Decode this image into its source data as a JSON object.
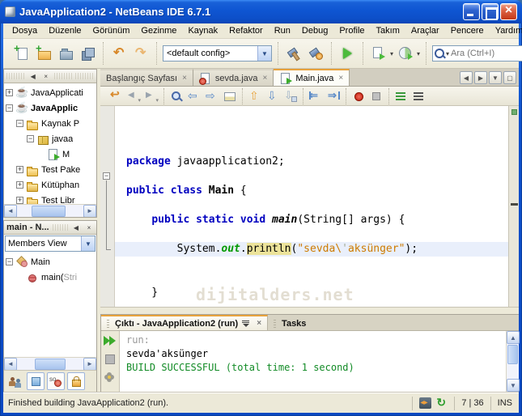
{
  "colors": {
    "keyword_blue": "#0000c0",
    "string_orange": "#ce7b00",
    "field_green": "#009900",
    "build_success_green": "#128b26",
    "active_tab_accent": "#e8a33d",
    "xp_titlebar_blue": "#0e55d2"
  },
  "window": {
    "title": "JavaApplication2 - NetBeans IDE 6.7.1",
    "controls": {
      "minimize": "minimize",
      "maximize": "maximize",
      "close": "close"
    }
  },
  "menubar": [
    "Dosya",
    "Düzenle",
    "Görünüm",
    "Gezinme",
    "Kaynak",
    "Refaktor",
    "Run",
    "Debug",
    "Profile",
    "Takım",
    "Araçlar",
    "Pencere",
    "Yardım"
  ],
  "toolbar": {
    "file_icons": [
      "new-file",
      "new-project",
      "open-project",
      "save-all"
    ],
    "edit_icons": [
      "undo",
      "redo"
    ],
    "config_combo_value": "<default config>",
    "build_icons": [
      "build-project",
      "clean-build-project"
    ],
    "run_icons": [
      "run-project"
    ],
    "dropdown_icons": [
      "debug-project",
      "profile-project"
    ],
    "search_placeholder": "Ara (Ctrl+I)"
  },
  "projects_panel": {
    "items": [
      {
        "label": "JavaApplicati",
        "expander": "+",
        "icon": "java-project",
        "bold": false,
        "level": 0
      },
      {
        "label": "JavaApplic",
        "expander": "-",
        "icon": "java-project",
        "bold": true,
        "level": 0
      },
      {
        "label": "Kaynak P",
        "expander": "-",
        "icon": "source-folder",
        "bold": false,
        "level": 1
      },
      {
        "label": "javaa",
        "expander": "-",
        "icon": "package",
        "bold": false,
        "level": 2
      },
      {
        "label": "M",
        "expander": null,
        "icon": "java-main-file",
        "bold": false,
        "level": 3
      },
      {
        "label": "Test Pake",
        "expander": "+",
        "icon": "source-folder",
        "bold": false,
        "level": 1
      },
      {
        "label": "Kütüphan",
        "expander": "+",
        "icon": "libraries-folder",
        "bold": false,
        "level": 1
      },
      {
        "label": "Test Libr",
        "expander": "+",
        "icon": "libraries-folder",
        "bold": false,
        "level": 1
      }
    ]
  },
  "navigator_panel": {
    "title": "main - N...",
    "view_combo_value": "Members View",
    "items": [
      {
        "label": "Main",
        "sub": "",
        "expander": "-",
        "icon": "class",
        "level": 0
      },
      {
        "label": "main(",
        "sub": "Stri",
        "expander": null,
        "icon": "method",
        "level": 1
      }
    ],
    "filter_icons": [
      "inherited-members",
      "show-fields",
      "show-static",
      "show-non-public"
    ]
  },
  "editor": {
    "tabs": [
      {
        "label": "Başlangıç Sayfası",
        "icon": null,
        "active": false
      },
      {
        "label": "sevda.java",
        "icon": "java-file-error",
        "active": false
      },
      {
        "label": "Main.java",
        "icon": "java-main-file",
        "active": true
      }
    ],
    "toolbar_groups": [
      [
        "last-edit-location",
        "back-history",
        "forward-history"
      ],
      [
        "find-selection",
        "find-previous",
        "find-next",
        "toggle-highlight"
      ],
      [
        "previous-occurrence",
        "next-occurrence",
        "toggle-bookmark"
      ],
      [
        "shift-left",
        "shift-right"
      ],
      [
        "record-macro",
        "run-macro"
      ],
      [
        "comment",
        "uncomment"
      ]
    ],
    "watermark": "dijitalders.net",
    "code_lines": [
      {
        "tokens": [
          {
            "t": "package",
            "c": "kw"
          },
          {
            "t": " javaapplication2;",
            "c": "pl"
          }
        ]
      },
      {
        "tokens": []
      },
      {
        "tokens": [
          {
            "t": "public class",
            "c": "kw"
          },
          {
            "t": " ",
            "c": "pl"
          },
          {
            "t": "Main",
            "c": "cls"
          },
          {
            "t": " {",
            "c": "pl"
          }
        ]
      },
      {
        "tokens": []
      },
      {
        "tokens": [
          {
            "t": "    ",
            "c": "pl"
          },
          {
            "t": "public static void",
            "c": "kw"
          },
          {
            "t": " ",
            "c": "pl"
          },
          {
            "t": "main",
            "c": "mtd"
          },
          {
            "t": "(String[] args) {",
            "c": "pl"
          }
        ],
        "fold_start": true
      },
      {
        "tokens": []
      },
      {
        "tokens": [
          {
            "t": "        System.",
            "c": "pl"
          },
          {
            "t": "out",
            "c": "fld"
          },
          {
            "t": ".",
            "c": "pl"
          },
          {
            "t": "println",
            "c": "pl hl"
          },
          {
            "t": "(",
            "c": "pl"
          },
          {
            "t": "\"sevda\\",
            "c": "str"
          },
          {
            "t": "'",
            "c": "esc"
          },
          {
            "t": "aksünger\"",
            "c": "str"
          },
          {
            "t": ");",
            "c": "pl"
          }
        ],
        "current": true
      },
      {
        "tokens": []
      },
      {
        "tokens": []
      },
      {
        "tokens": [
          {
            "t": "    }",
            "c": "pl"
          }
        ],
        "fold_end": true
      },
      {
        "tokens": []
      },
      {
        "tokens": [
          {
            "t": "}",
            "c": "pl"
          }
        ]
      }
    ]
  },
  "output_panel": {
    "tabs": [
      {
        "label": "Çıktı - JavaApplication2 (run)",
        "active": true
      },
      {
        "label": "Tasks",
        "active": false
      }
    ],
    "action_icons": [
      "rerun",
      "stop-run",
      "ant-settings"
    ],
    "lines": [
      {
        "text": "run:",
        "style": "muted"
      },
      {
        "text": "sevda'aksünger",
        "style": "plain"
      },
      {
        "text": "BUILD SUCCESSFUL (total time: 1 second)",
        "style": "success"
      }
    ]
  },
  "statusbar": {
    "message": "Finished building JavaApplication2 (run).",
    "caret_position": "7 | 36",
    "insert_mode": "INS"
  }
}
